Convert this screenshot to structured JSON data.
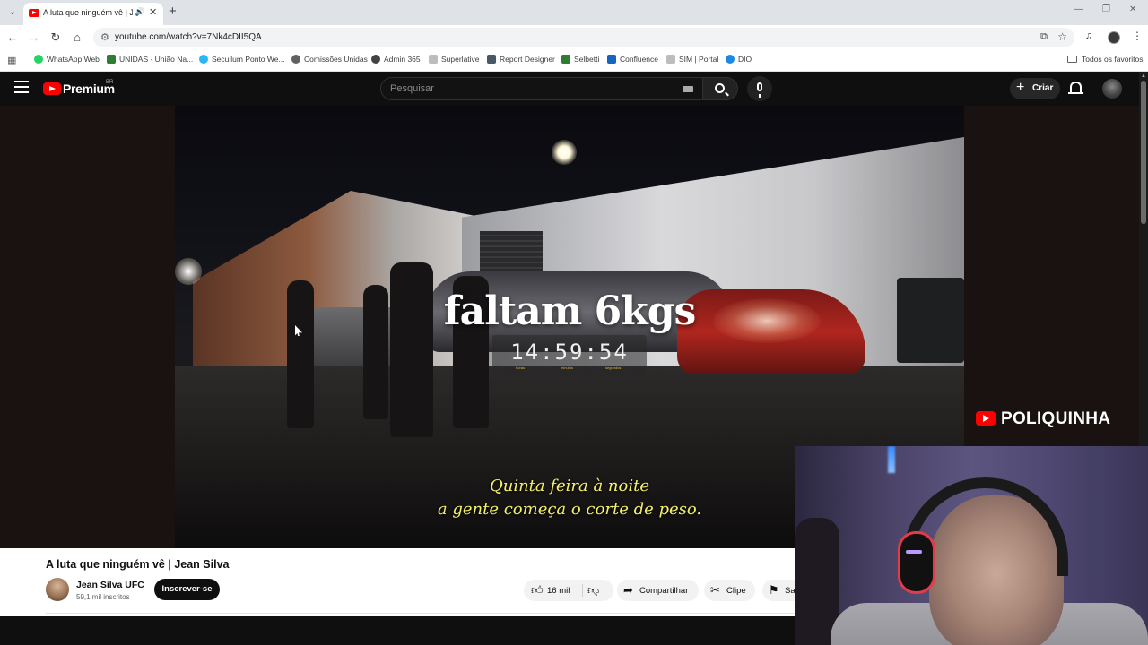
{
  "browser": {
    "tab_title": "A luta que ninguém vê | Jean Silva",
    "url": "youtube.com/watch?v=7Nk4cDII5QA",
    "bookmarks": [
      {
        "label": "WhatsApp Web",
        "color": "#25d366"
      },
      {
        "label": "UNIDAS - União Na...",
        "color": "#2e7d32"
      },
      {
        "label": "Secullum Ponto We...",
        "color": "#29b6f6"
      },
      {
        "label": "Comissões Unidas",
        "color": "#616161"
      },
      {
        "label": "Admin 365",
        "color": "#424242"
      },
      {
        "label": "Superlative",
        "color": "#9e9e9e"
      },
      {
        "label": "Report Designer",
        "color": "#455a64"
      },
      {
        "label": "Selbetti",
        "color": "#2e7d32"
      },
      {
        "label": "Confluence",
        "color": "#1565c0"
      },
      {
        "label": "SIM | Portal",
        "color": "#9e9e9e"
      },
      {
        "label": "DIO",
        "color": "#1e88e5"
      }
    ],
    "all_bookmarks_label": "Todos os favoritos"
  },
  "youtube": {
    "logo_text": "Premium",
    "country_code": "BR",
    "search_placeholder": "Pesquisar",
    "create_label": "Criar"
  },
  "video": {
    "overlay_title": "faltam 6kgs",
    "countdown": "14:59:54",
    "countdown_labels": [
      "horas",
      "minutos",
      "segundos"
    ],
    "subtitle_line1": "Quinta feira à noite",
    "subtitle_line2": "a gente começa o corte de peso.",
    "watermark": "POLIQUINHA"
  },
  "info": {
    "title": "A luta que ninguém vê | Jean Silva",
    "channel_name": "Jean Silva UFC",
    "subscribers": "59,1 mil inscritos",
    "subscribe_label": "Inscrever-se",
    "like_count": "16 mil",
    "share_label": "Compartilhar",
    "clip_label": "Clipe",
    "save_label": "Sal"
  },
  "colors": {
    "brand_red": "#ff0000",
    "subtitle_yellow": "#f4ef6a"
  }
}
